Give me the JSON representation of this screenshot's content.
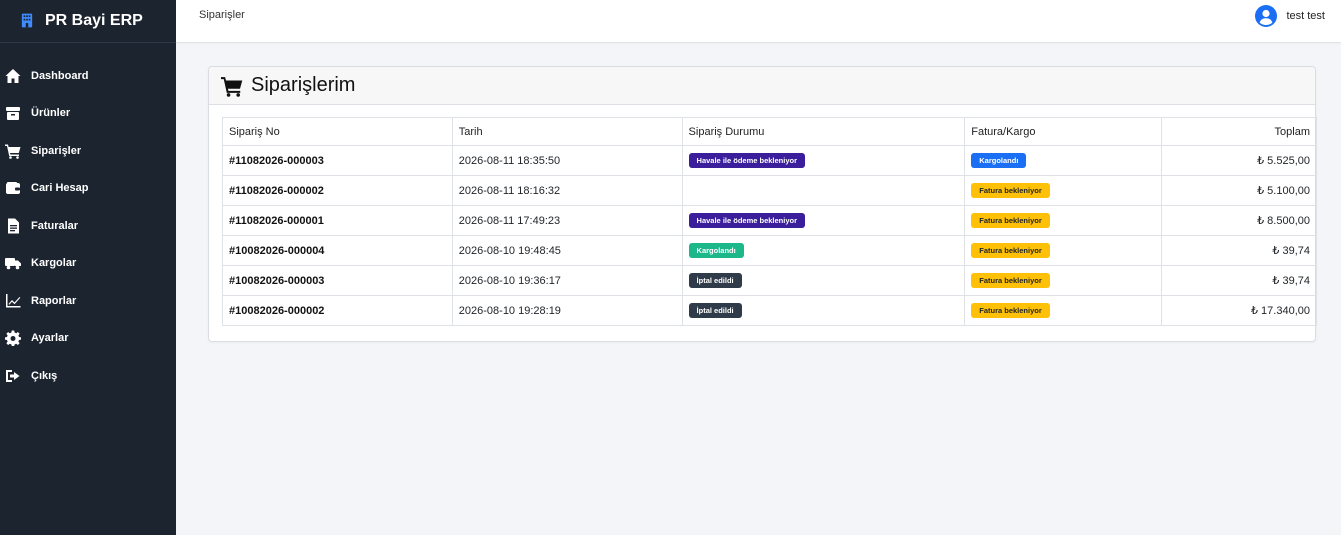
{
  "brand": {
    "name": "PR Bayi ERP"
  },
  "sidebar": {
    "items": [
      {
        "label": "Dashboard",
        "icon": "home-icon"
      },
      {
        "label": "Ürünler",
        "icon": "box-icon"
      },
      {
        "label": "Siparişler",
        "icon": "cart-icon"
      },
      {
        "label": "Cari Hesap",
        "icon": "wallet-icon"
      },
      {
        "label": "Faturalar",
        "icon": "invoice-icon"
      },
      {
        "label": "Kargolar",
        "icon": "truck-icon"
      },
      {
        "label": "Raporlar",
        "icon": "chart-line-icon"
      },
      {
        "label": "Ayarlar",
        "icon": "gear-icon"
      },
      {
        "label": "Çıkış",
        "icon": "logout-icon"
      }
    ]
  },
  "header": {
    "breadcrumb": "Siparişler",
    "user_name": "test test"
  },
  "main": {
    "title": "Siparişlerim",
    "columns": [
      "Sipariş No",
      "Tarih",
      "Sipariş Durumu",
      "Fatura/Kargo",
      "Toplam"
    ],
    "rows": [
      {
        "no": "#11082026-000003",
        "date": "2026-08-11 18:35:50",
        "status": "Havale ile ödeme bekleniyor",
        "status_color": "#3a1e9c",
        "ship": "Kargolandı",
        "ship_color": "#1a6ff5",
        "total": "₺ 5.525,00"
      },
      {
        "no": "#11082026-000002",
        "date": "2026-08-11 18:16:32",
        "status": "",
        "status_color": "",
        "ship": "Fatura bekleniyor",
        "ship_color": "#ffc107",
        "total": "₺ 5.100,00"
      },
      {
        "no": "#11082026-000001",
        "date": "2026-08-11 17:49:23",
        "status": "Havale ile ödeme bekleniyor",
        "status_color": "#3a1e9c",
        "ship": "Fatura bekleniyor",
        "ship_color": "#ffc107",
        "total": "₺ 8.500,00"
      },
      {
        "no": "#10082026-000004",
        "date": "2026-08-10 19:48:45",
        "status": "Kargolandı",
        "status_color": "#1cb88a",
        "ship": "Fatura bekleniyor",
        "ship_color": "#ffc107",
        "total": "₺ 39,74"
      },
      {
        "no": "#10082026-000003",
        "date": "2026-08-10 19:36:17",
        "status": "İptal edildi",
        "status_color": "#2f3b48",
        "ship": "Fatura bekleniyor",
        "ship_color": "#ffc107",
        "total": "₺ 39,74"
      },
      {
        "no": "#10082026-000002",
        "date": "2026-08-10 19:28:19",
        "status": "İptal edildi",
        "status_color": "#2f3b48",
        "ship": "Fatura bekleniyor",
        "ship_color": "#ffc107",
        "total": "₺ 17.340,00"
      }
    ]
  },
  "colors": {
    "sidebar_bg": "#1c2430",
    "brand_icon": "#3d8bfd",
    "avatar": "#1a6ff5",
    "page_bg": "#f4f5f9"
  }
}
